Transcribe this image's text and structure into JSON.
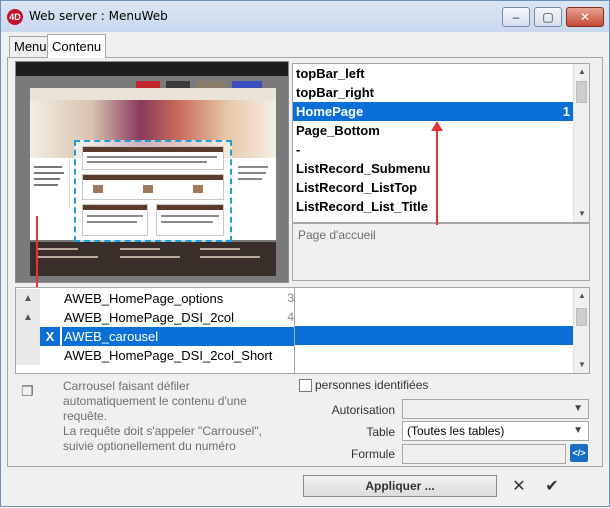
{
  "window": {
    "title": "Web server : MenuWeb",
    "app_icon": "4D"
  },
  "controls": {
    "minimize": "–",
    "maximize": "▢",
    "close": "✕"
  },
  "tabs": [
    {
      "label": "Menu"
    },
    {
      "label": "Contenu"
    }
  ],
  "top_list": {
    "items": [
      {
        "label": "topBar_left",
        "num": ""
      },
      {
        "label": "topBar_right",
        "num": ""
      },
      {
        "label": "HomePage",
        "num": "1"
      },
      {
        "label": "Page_Bottom",
        "num": ""
      },
      {
        "label": "-",
        "num": ""
      },
      {
        "label": "ListRecord_Submenu",
        "num": ""
      },
      {
        "label": "ListRecord_ListTop",
        "num": ""
      },
      {
        "label": "ListRecord_List_Title",
        "num": ""
      }
    ],
    "selected_index": 2
  },
  "top_description": "Page d'accueil",
  "bottom_list": {
    "items": [
      {
        "label": "AWEB_HomePage_options",
        "num": "3",
        "marker": "▲"
      },
      {
        "label": "AWEB_HomePage_DSI_2col",
        "num": "4",
        "marker": "▲"
      },
      {
        "label": "AWEB_carousel",
        "num": "",
        "marker": "X"
      },
      {
        "label": "AWEB_HomePage_DSI_2col_Short",
        "num": "",
        "marker": ""
      }
    ],
    "selected_index": 2
  },
  "bottom_description": "Carrousel faisant défiler automatiquement le contenu d'une requête.\nLa requête doit s'appeler \"Carrousel\", suivie optionellement du numéro",
  "filters": {
    "identified_label": "personnes identifiées",
    "autorisation_label": "Autorisation",
    "autorisation_value": "",
    "table_label": "Table",
    "table_value": "(Toutes les tables)",
    "formule_label": "Formule",
    "formule_value": ""
  },
  "buttons": {
    "apply": "Appliquer ...",
    "cancel_icon": "✕",
    "ok_icon": "✔",
    "code_icon": "</>"
  },
  "colors": {
    "selection": "#0a6fd6",
    "arrow": "#e23434",
    "dashed": "#1ea0d8"
  }
}
